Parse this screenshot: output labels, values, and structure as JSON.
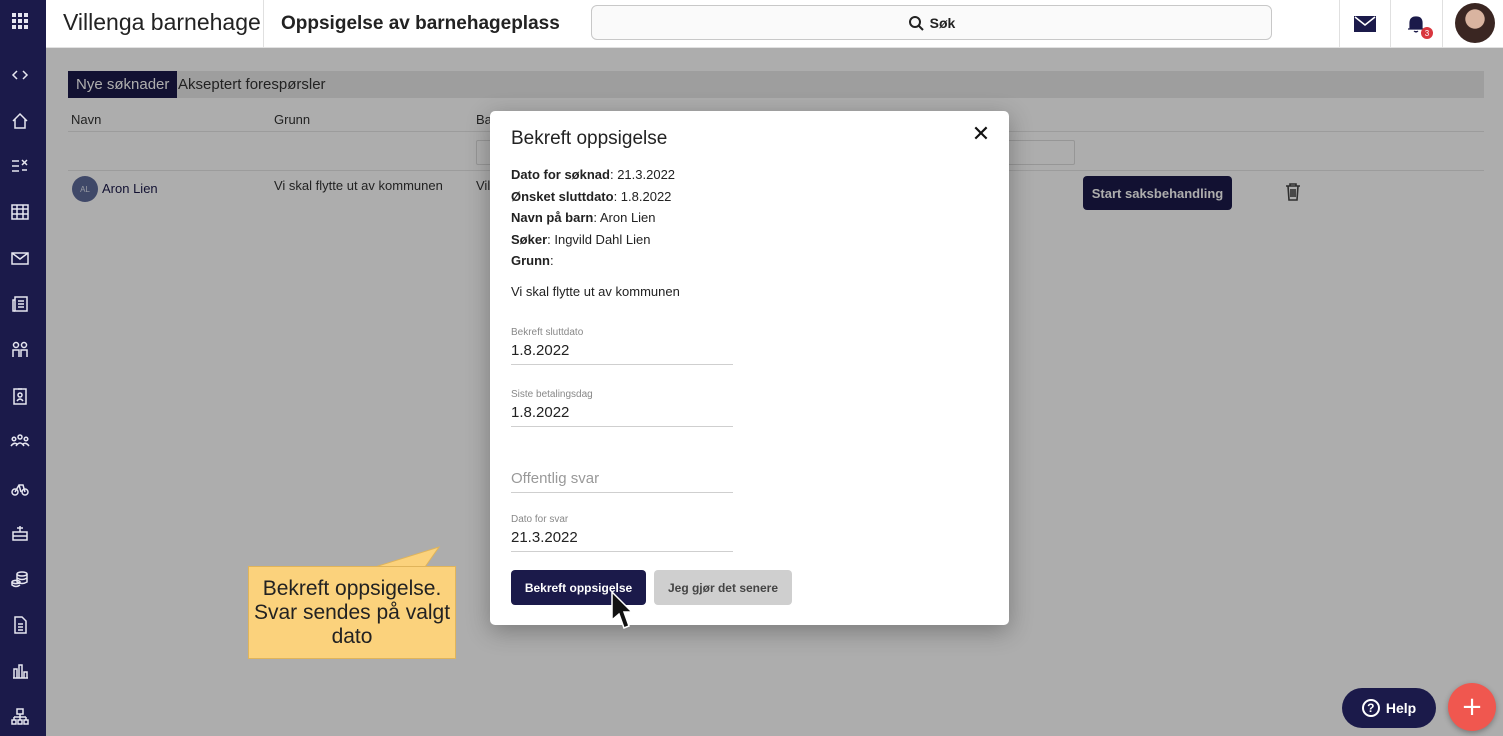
{
  "header": {
    "brand": "Villenga barnehage",
    "page_title": "Oppsigelse av barnehageplass",
    "search_label": "Søk",
    "notification_count": "3"
  },
  "tabs": [
    {
      "label": "Nye søknader",
      "active": true
    },
    {
      "label": "Akseptert forespørsler",
      "active": false
    }
  ],
  "table": {
    "columns": [
      "Navn",
      "Grunn",
      "Ba"
    ],
    "rows": [
      {
        "initials": "AL",
        "name": "Aron Lien",
        "reason": "Vi skal flytte ut av kommunen",
        "truncated": "Vil",
        "action_label": "Start saksbehandling"
      }
    ]
  },
  "modal": {
    "title": "Bekreft oppsigelse",
    "close_label": "✕",
    "info": [
      {
        "label": "Dato for søknad",
        "value": ": 21.3.2022"
      },
      {
        "label": "Ønsket sluttdato",
        "value": ": 1.8.2022"
      },
      {
        "label": "Navn på barn",
        "value": ": Aron Lien"
      },
      {
        "label": "Søker",
        "value": ": Ingvild Dahl Lien"
      },
      {
        "label": "Grunn",
        "value": ":"
      }
    ],
    "reason_text": "Vi skal flytte ut av kommunen",
    "fields": {
      "end_date": {
        "label": "Bekreft sluttdato",
        "value": "1.8.2022"
      },
      "last_payment": {
        "label": "Siste betalingsdag",
        "value": "1.8.2022"
      },
      "public_reply": {
        "placeholder": "Offentlig svar",
        "value": ""
      },
      "reply_date": {
        "label": "Dato for svar",
        "value": "21.3.2022"
      }
    },
    "confirm_label": "Bekreft oppsigelse",
    "later_label": "Jeg gjør det senere"
  },
  "callout": {
    "text": "Bekreft oppsigelse. Svar sendes på valgt dato"
  },
  "help_label": "Help",
  "fab_label": "+",
  "colors": {
    "primary": "#1b1a4a",
    "accent": "#f0574f",
    "callout": "#fbd27c"
  }
}
